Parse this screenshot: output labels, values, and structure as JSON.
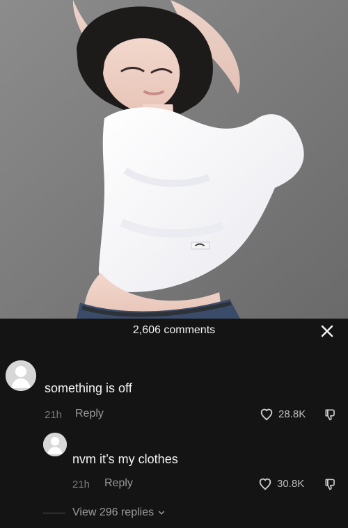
{
  "header": {
    "comment_count": "2,606 comments"
  },
  "comments": [
    {
      "text": "something is off",
      "time": "21h",
      "reply_label": "Reply",
      "likes": "28.8K"
    },
    {
      "text": "nvm it’s my clothes",
      "time": "21h",
      "reply_label": "Reply",
      "likes": "30.8K"
    }
  ],
  "view_replies": {
    "label": "View 296 replies"
  },
  "icons": {
    "close": "close-icon",
    "avatar": "default-avatar-icon",
    "like": "heart-outline-icon",
    "dislike": "thumbs-down-icon",
    "chevron": "chevron-down-icon"
  },
  "colors": {
    "panel_background": "#141414",
    "text_primary": "#f4f4f4",
    "text_secondary": "#9a9a9a"
  }
}
